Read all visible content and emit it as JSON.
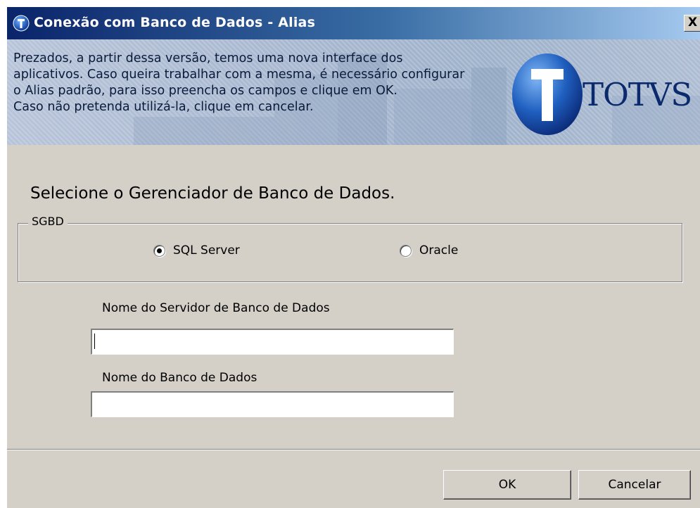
{
  "window": {
    "title": "Conexão com Banco de Dados - Alias",
    "close_label": "X"
  },
  "banner": {
    "lines": [
      "Prezados, a partir dessa versão, temos uma nova interface dos",
      "aplicativos. Caso queira trabalhar com a mesma, é necessário configurar",
      "o Alias padrão, para isso preencha os campos e clique em OK.",
      "Caso não pretenda utilizá-la, clique em cancelar."
    ],
    "logo_text": "TOTVS"
  },
  "main": {
    "heading": "Selecione o Gerenciador de Banco de Dados.",
    "sgbd_group": {
      "legend": "SGBD",
      "options": [
        {
          "label": "SQL Server",
          "selected": true
        },
        {
          "label": "Oracle",
          "selected": false
        }
      ]
    },
    "server_field": {
      "label": "Nome do Servidor de Banco de Dados",
      "value": ""
    },
    "database_field": {
      "label": "Nome do Banco de Dados",
      "value": ""
    }
  },
  "footer": {
    "ok_label": "OK",
    "cancel_label": "Cancelar"
  },
  "colors": {
    "title_bar_start": "#0a246a",
    "window_face": "#d4d0c8",
    "logo_blue": "#0b2a6e"
  },
  "icons": {
    "title": "totvs-app-icon",
    "logo": "totvs-sphere-logo"
  }
}
